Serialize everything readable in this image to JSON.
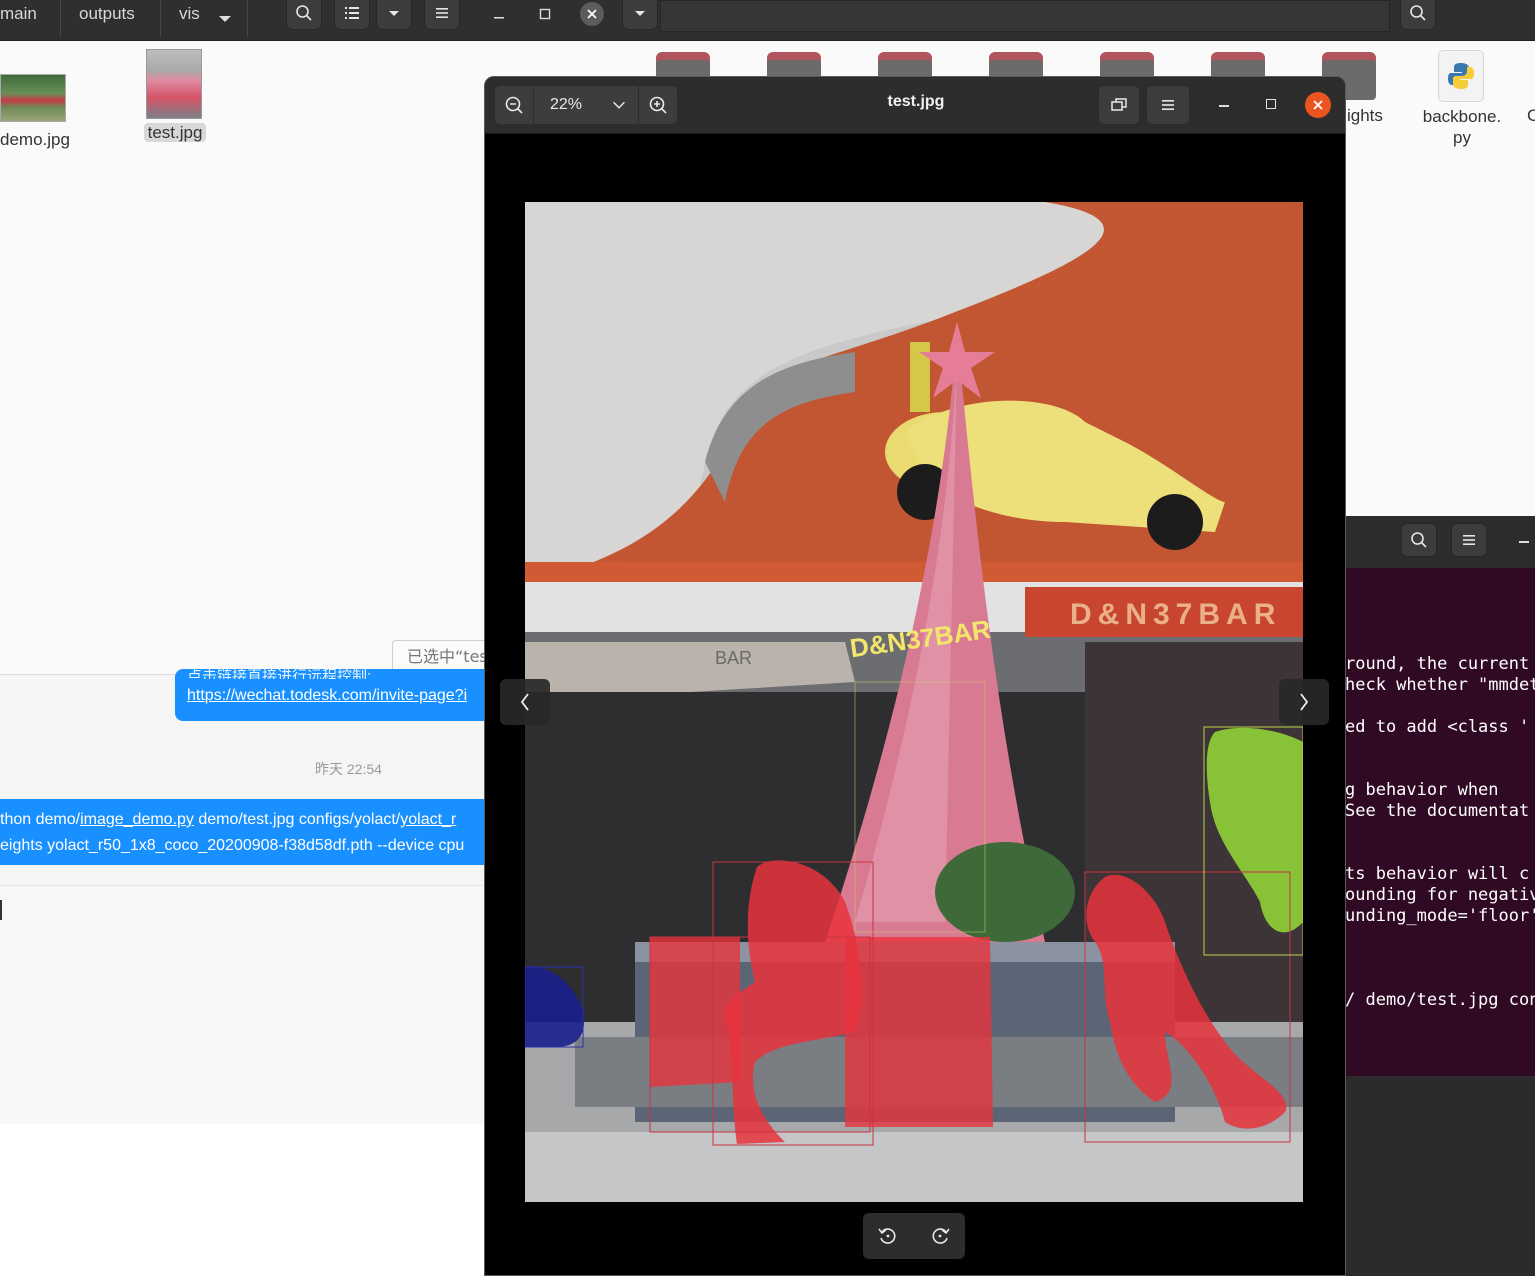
{
  "left_file_manager": {
    "breadcrumbs": [
      "main",
      "outputs",
      "vis"
    ],
    "files": [
      {
        "name": "demo.jpg"
      },
      {
        "name": "test.jpg",
        "selected": true
      }
    ],
    "status_text": "已选中“tes"
  },
  "right_file_manager": {
    "partial_folder_label": "ights",
    "python_file_label_line1": "backbone.",
    "python_file_label_line2": "py",
    "edge_char": "C"
  },
  "chat": {
    "garbled_top_text": "点击链接直接进行远程控制:",
    "link": "https://wechat.todesk.com/invite-page?i",
    "timestamp": "昨天 22:54",
    "message_line1_prefix": "thon demo/",
    "message_line1_link": "image_demo.py",
    "message_line1_mid": " demo/test.jpg configs/yolact/",
    "message_line1_link2": "yolact_r",
    "message_line2": "eights yolact_r50_1x8_coco_20200908-f38d58df.pth --device cpu"
  },
  "terminal": {
    "lines": [
      "round, the current",
      "heck whether \"mmdet",
      "",
      "ed to add <class '",
      "",
      "",
      "g behavior when",
      "See the documentat",
      "",
      "",
      "ts behavior will c",
      "ounding for negativ",
      "unding_mode='floor'",
      "",
      "",
      "",
      "/ demo/test.jpg con"
    ]
  },
  "viewer": {
    "zoom": "22%",
    "title": "test.jpg",
    "photo_sign_text": "D&N37BAR",
    "photo_sign_text_2": "D&N37BAR",
    "photo_small_sign": "BAR"
  },
  "colors": {
    "accent_orange": "#e95420",
    "chat_blue": "#1890ff",
    "terminal_bg": "#300a24",
    "mask_red": "#e8333c",
    "mask_green": "#8fd137",
    "mask_blue": "#1a1f8c"
  }
}
